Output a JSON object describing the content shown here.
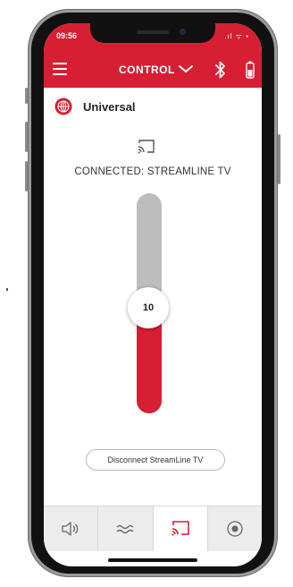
{
  "status_bar": {
    "time": "09:56",
    "icons": ".ıl ᯤ ▪"
  },
  "app_bar": {
    "title": "CONTROL"
  },
  "profile": {
    "name": "Universal"
  },
  "connection": {
    "status_text": "CONNECTED: STREAMLINE TV"
  },
  "volume": {
    "value": "10",
    "level_fraction": 0.48
  },
  "disconnect": {
    "label": "Disconnect StreamLine TV"
  },
  "tabs": [
    {
      "icon": "speaker-icon",
      "active": false
    },
    {
      "icon": "waves-icon",
      "active": false
    },
    {
      "icon": "cast-icon",
      "active": true
    },
    {
      "icon": "record-icon",
      "active": false
    }
  ],
  "colors": {
    "accent": "#d71f33",
    "slider_track": "#bdbdbd",
    "tab_bar": "#ececec"
  }
}
